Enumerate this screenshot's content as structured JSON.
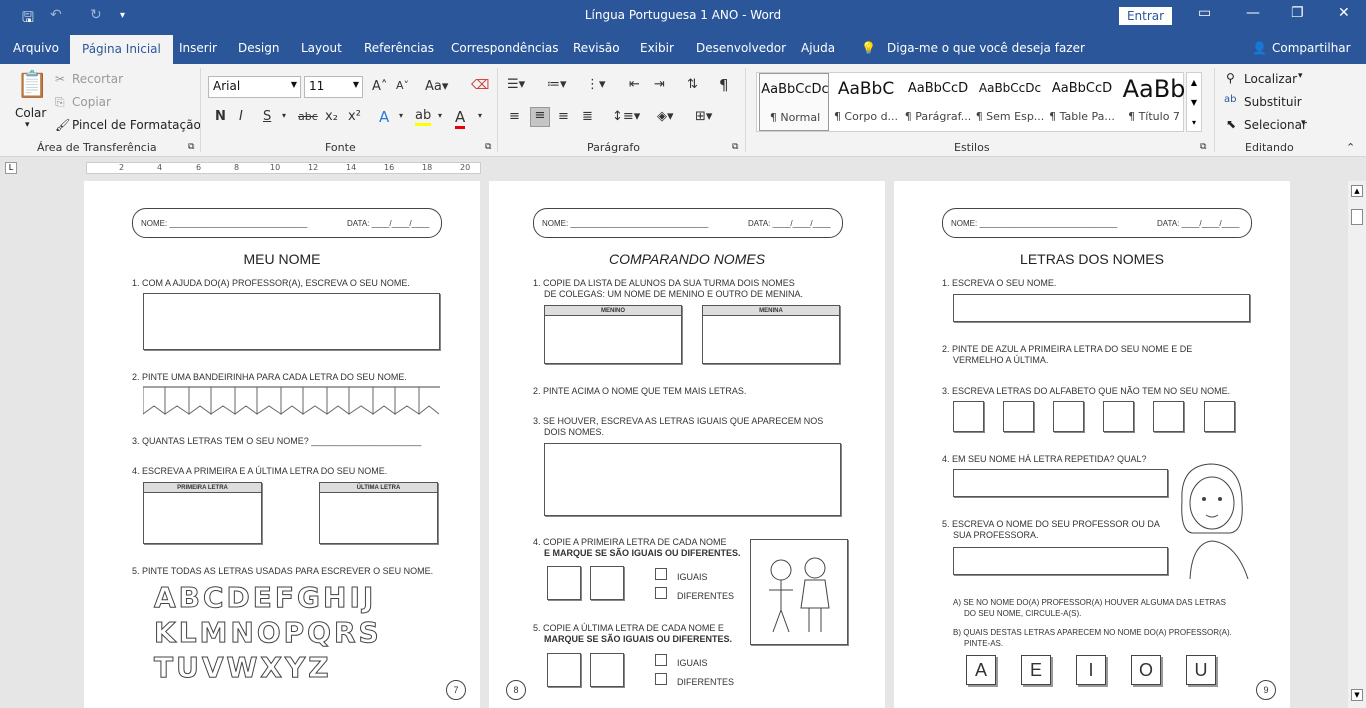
{
  "titlebar": {
    "title": "Língua Portuguesa  1 ANO  -  Word",
    "signin": "Entrar"
  },
  "tabs": [
    "Arquivo",
    "Página Inicial",
    "Inserir",
    "Design",
    "Layout",
    "Referências",
    "Correspondências",
    "Revisão",
    "Exibir",
    "Desenvolvedor",
    "Ajuda"
  ],
  "tellme": "Diga-me o que você deseja fazer",
  "share": "Compartilhar",
  "clipboard": {
    "paste": "Colar",
    "cut": "Recortar",
    "copy": "Copiar",
    "painter": "Pincel de Formatação",
    "label": "Área de Transferência"
  },
  "font": {
    "name": "Arial",
    "size": "11",
    "label": "Fonte"
  },
  "paragraph": {
    "label": "Parágrafo"
  },
  "styles": {
    "label": "Estilos",
    "items": [
      {
        "preview": "AaBbCcDc",
        "name": "¶ Normal"
      },
      {
        "preview": "AaBbC",
        "name": "¶ Corpo d..."
      },
      {
        "preview": "AaBbCcD",
        "name": "¶ Parágraf..."
      },
      {
        "preview": "AaBbCcDc",
        "name": "¶ Sem Esp..."
      },
      {
        "preview": "AaBbCcD",
        "name": "¶ Table Pa..."
      },
      {
        "preview": "AaBb",
        "name": "¶ Título 7"
      }
    ]
  },
  "editing": {
    "find": "Localizar",
    "replace": "Substituir",
    "select": "Selecionar",
    "label": "Editando"
  },
  "ruler": [
    "2",
    "4",
    "6",
    "8",
    "10",
    "12",
    "14",
    "16",
    "18",
    "20"
  ],
  "page1": {
    "name_label": "NOME: _______________________________",
    "date_label": "DATA: ____/____/____",
    "title": "MEU NOME",
    "q1": "1. COM A AJUDA DO(A) PROFESSOR(A), ESCREVA O SEU NOME.",
    "q2": "2. PINTE UMA BANDEIRINHA PARA CADA LETRA DO SEU NOME.",
    "q3": "3. QUANTAS LETRAS TEM O SEU NOME? ______________________",
    "q4": "4. ESCREVA A PRIMEIRA E A ÚLTIMA LETRA DO SEU NOME.",
    "first": "PRIMEIRA LETRA",
    "last": "ÚLTIMA LETRA",
    "q5": "5. PINTE TODAS AS LETRAS USADAS PARA ESCREVER O SEU NOME.",
    "letters": [
      "ABCDEFGHIJ",
      "KLMNOPQRS",
      "TUVWXYZ"
    ],
    "page_num": "7"
  },
  "page2": {
    "name_label": "NOME: _______________________________",
    "date_label": "DATA: ____/____/____",
    "title": "COMPARANDO NOMES",
    "q1a": "1. COPIE DA LISTA DE ALUNOS DA SUA TURMA DOIS NOMES",
    "q1b": "DE COLEGAS: UM NOME DE MENINO E OUTRO DE MENINA.",
    "boy": "MENINO",
    "girl": "MENINA",
    "q2": "2. PINTE ACIMA O NOME QUE TEM MAIS LETRAS.",
    "q3a": "3. SE HOUVER, ESCREVA AS LETRAS IGUAIS QUE APARECEM NOS",
    "q3b": "DOIS NOMES.",
    "q4a": "4. COPIE A PRIMEIRA LETRA DE CADA NOME",
    "q4b": "E MARQUE SE SÃO IGUAIS OU DIFERENTES.",
    "equal": "IGUAIS",
    "different": "DIFERENTES",
    "q5a": "5. COPIE A ÚLTIMA LETRA DE CADA NOME E",
    "q5b": "MARQUE SE SÃO IGUAIS OU DIFERENTES.",
    "page_num": "8"
  },
  "page3": {
    "name_label": "NOME: _______________________________",
    "date_label": "DATA: ____/____/____",
    "title": "LETRAS DOS NOMES",
    "q1": "1. ESCREVA O SEU NOME.",
    "q2a": "2. PINTE DE AZUL A PRIMEIRA LETRA DO SEU NOME E DE",
    "q2b": "VERMELHO A ÚLTIMA.",
    "q3": "3. ESCREVA LETRAS DO ALFABETO QUE NÃO TEM NO SEU NOME.",
    "q4": "4. EM SEU NOME HÁ LETRA REPETIDA? QUAL?",
    "q5a": "5. ESCREVA O NOME DO SEU PROFESSOR OU DA",
    "q5b": "SUA PROFESSORA.",
    "qAa": "A) SE NO NOME DO(A) PROFESSOR(A) HOUVER ALGUMA DAS LETRAS",
    "qAb": "DO SEU NOME, CIRCULE-A(S).",
    "qBa": "B) QUAIS DESTAS LETRAS APARECEM NO NOME DO(A) PROFESSOR(A).",
    "qBb": "PINTE-AS.",
    "vowels": [
      "A",
      "E",
      "I",
      "O",
      "U"
    ],
    "page_num": "9"
  }
}
